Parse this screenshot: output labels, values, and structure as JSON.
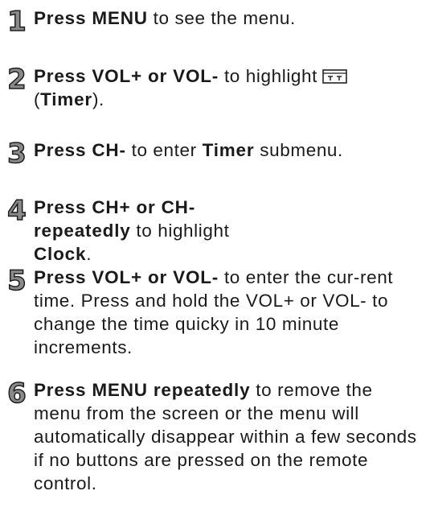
{
  "steps": [
    {
      "number": "1",
      "segments": [
        {
          "text": "Press MENU",
          "bold": true
        },
        {
          "text": " to see the menu.",
          "bold": false
        }
      ]
    },
    {
      "number": "2",
      "line1": [
        {
          "text": "Press VOL+ or VOL-",
          "bold": true
        },
        {
          "text": " to highlight",
          "bold": false
        }
      ],
      "icon": "timer-icon",
      "line2": [
        {
          "text": "(",
          "bold": false
        },
        {
          "text": "Timer",
          "bold": true
        },
        {
          "text": ").",
          "bold": false
        }
      ]
    },
    {
      "number": "3",
      "segments": [
        {
          "text": "Press CH-",
          "bold": true
        },
        {
          "text": " to enter ",
          "bold": false
        },
        {
          "text": "Timer",
          "bold": true
        },
        {
          "text": " submenu.",
          "bold": false
        }
      ]
    },
    {
      "number": "4",
      "segments": [
        {
          "text": "Press CH+ or CH- repeatedly",
          "bold": true
        },
        {
          "text": " to highlight ",
          "bold": false
        },
        {
          "text": "Clock",
          "bold": true
        },
        {
          "text": ".",
          "bold": false
        }
      ]
    },
    {
      "number": "5",
      "segments": [
        {
          "text": "Press VOL+ or VOL-",
          "bold": true
        },
        {
          "text": " to enter the cur-rent time. Press and hold the VOL+ or VOL- to change the time quicky in 10 minute increments.",
          "bold": false
        }
      ]
    },
    {
      "number": "6",
      "segments": [
        {
          "text": "Press MENU repeatedly",
          "bold": true
        },
        {
          "text": " to remove the menu from the screen or the menu will automatically disappear within a few seconds if no buttons are pressed on the remote control.",
          "bold": false
        }
      ]
    }
  ]
}
